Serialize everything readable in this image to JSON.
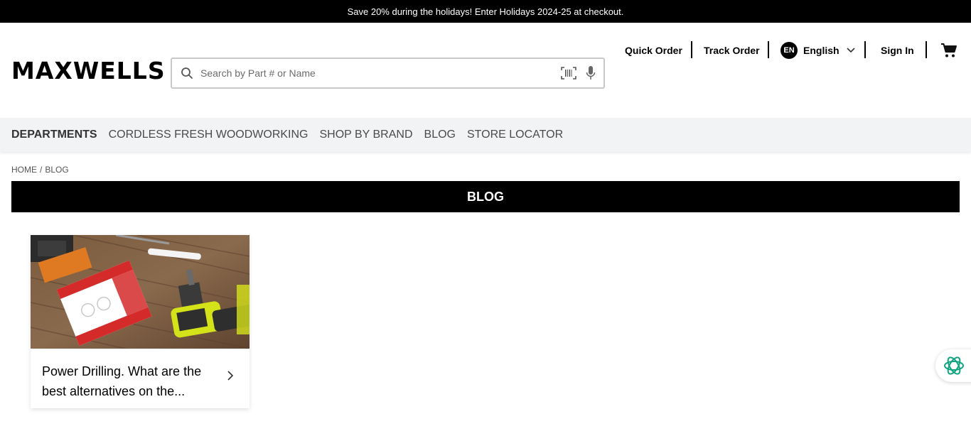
{
  "promo": {
    "text": "Save 20% during the holidays! Enter Holidays 2024-25 at checkout."
  },
  "header": {
    "logo": "MAXWELLS",
    "search": {
      "placeholder": "Search by Part # or Name",
      "value": ""
    },
    "quick_order": "Quick Order",
    "track_order": "Track Order",
    "language": {
      "code": "EN",
      "label": "English"
    },
    "sign_in": "Sign In",
    "icons": [
      "search-icon",
      "barcode-icon",
      "mic-icon",
      "chevron-down-icon",
      "cart-icon"
    ]
  },
  "nav": {
    "items": [
      "DEPARTMENTS",
      "CORDLESS FRESH WOODWORKING",
      "SHOP BY BRAND",
      "BLOG",
      "STORE LOCATOR"
    ]
  },
  "breadcrumb": {
    "home": "HOME",
    "separator": "/",
    "current": "BLOG"
  },
  "page_title": "BLOG",
  "posts": [
    {
      "title": "Power Drilling. What are the best alternatives on the..."
    }
  ],
  "colors": {
    "accent": "#000000",
    "nav_bg": "#f2f3f5",
    "drill_yellow": "#d4e21a",
    "assistant_green": "#10a37f"
  }
}
